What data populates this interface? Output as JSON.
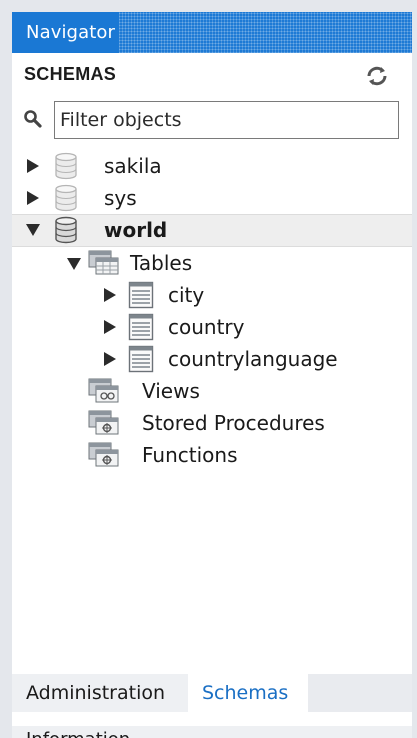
{
  "navigator": {
    "title": "Navigator",
    "section_label": "SCHEMAS",
    "filter": {
      "placeholder": "Filter objects",
      "value": ""
    }
  },
  "tree": {
    "schemas": [
      {
        "label": "sakila",
        "expanded": false
      },
      {
        "label": "sys",
        "expanded": false
      },
      {
        "label": "world",
        "expanded": true
      }
    ],
    "world": {
      "tables_label": "Tables",
      "tables": [
        "city",
        "country",
        "countrylanguage"
      ],
      "views_label": "Views",
      "procedures_label": "Stored Procedures",
      "functions_label": "Functions"
    }
  },
  "tabs": {
    "administration": "Administration",
    "schemas": "Schemas",
    "active": "Schemas"
  },
  "info": {
    "label": "Information"
  },
  "colors": {
    "header_blue": "#1a78d4",
    "active_tab_text": "#1a6fc4"
  },
  "icons": {
    "refresh": "refresh-icon",
    "search": "search-icon",
    "database": "database-icon",
    "folder": "folder-icon",
    "table": "table-icon"
  }
}
